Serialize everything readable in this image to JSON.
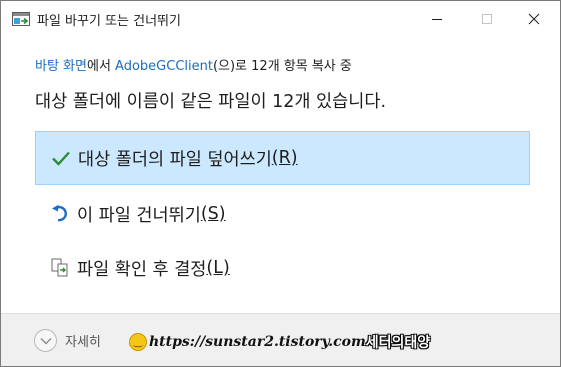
{
  "window": {
    "title": "파일 바꾸기 또는 건너뛰기",
    "controls": {
      "minimize": "minimize",
      "maximize": "maximize",
      "close": "close"
    }
  },
  "subtitle": {
    "source": "바탕 화면",
    "part1": "에서 ",
    "destination": "AdobeGCClient",
    "part2": "(으)로 12개 항목 복사 중"
  },
  "headline": "대상 폴더에 이름이 같은 파일이 12개 있습니다.",
  "options": [
    {
      "label": "대상 폴더의 파일 덮어쓰기",
      "key": "(R)",
      "icon": "checkmark-icon",
      "selected": true
    },
    {
      "label": "이 파일 건너뛰기",
      "key": "(S)",
      "icon": "skip-arrow-icon",
      "selected": false
    },
    {
      "label": "파일 확인 후 결정",
      "key": "(L)",
      "icon": "compare-files-icon",
      "selected": false
    }
  ],
  "footer": {
    "details_label": "자세히",
    "details_icon": "chevron-down-icon"
  },
  "watermark": {
    "url": "https://sunstar2.tistory.com",
    "name": "세터의태양"
  },
  "colors": {
    "link": "#1a6ec0",
    "selected_bg": "#cce8ff",
    "selected_border": "#99d1ff",
    "check": "#2e8b3a",
    "footer_bg": "#f0f0f0"
  }
}
